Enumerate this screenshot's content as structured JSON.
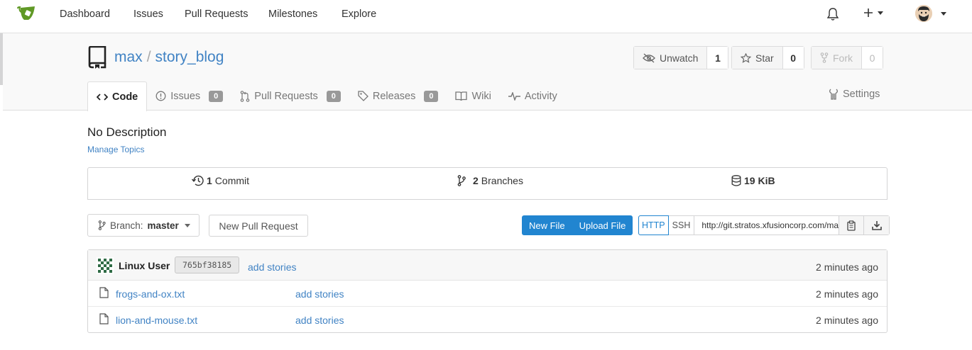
{
  "colors": {
    "link": "#4183c4",
    "primary": "#2185d0",
    "logo_green": "#609926"
  },
  "nav": {
    "items": [
      "Dashboard",
      "Issues",
      "Pull Requests",
      "Milestones",
      "Explore"
    ],
    "icons": [
      "gitea-logo-icon",
      "bell-icon",
      "plus-icon",
      "caret-down-icon",
      "avatar"
    ]
  },
  "repo": {
    "owner": "max",
    "separator": "/",
    "name": "story_blog",
    "watch": {
      "label": "Unwatch",
      "count": "1"
    },
    "star": {
      "label": "Star",
      "count": "0"
    },
    "fork": {
      "label": "Fork",
      "count": "0"
    }
  },
  "tabs": {
    "code": "Code",
    "issues": "Issues",
    "issues_count": "0",
    "pulls": "Pull Requests",
    "pulls_count": "0",
    "releases": "Releases",
    "releases_count": "0",
    "wiki": "Wiki",
    "activity": "Activity",
    "settings": "Settings"
  },
  "description": "No Description",
  "manage_topics": "Manage Topics",
  "stats": {
    "commits_num": "1",
    "commits_label": "Commit",
    "branches_num": "2",
    "branches_label": "Branches",
    "size": "19 KiB"
  },
  "toolbar": {
    "branch_prefix": "Branch:",
    "branch": "master",
    "new_pull_request": "New Pull Request",
    "new_file": "New File",
    "upload_file": "Upload File",
    "http": "HTTP",
    "ssh": "SSH",
    "clone_url": "http://git.stratos.xfusioncorp.com/max/story_blog.git"
  },
  "latest_commit": {
    "author": "Linux User",
    "sha": "765bf38185",
    "message": "add stories",
    "time": "2 minutes ago"
  },
  "files": [
    {
      "name": "frogs-and-ox.txt",
      "message": "add stories",
      "time": "2 minutes ago"
    },
    {
      "name": "lion-and-mouse.txt",
      "message": "add stories",
      "time": "2 minutes ago"
    }
  ]
}
